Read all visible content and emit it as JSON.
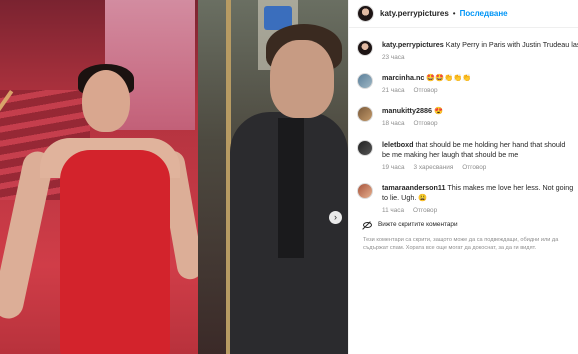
{
  "post": {
    "username": "katy.perrypictures",
    "separator": "•",
    "follow_label": "Последване"
  },
  "caption": {
    "username": "katy.perrypictures",
    "text": "Katy Perry in Paris with Justin Trudeau last night",
    "time": "23 часа"
  },
  "comments": [
    {
      "username": "marcinha.nc",
      "text": "🤩🤩👏👏👏",
      "time": "21 часа",
      "reply_label": "Отговор"
    },
    {
      "username": "manukitty2886",
      "text": "😍",
      "time": "18 часа",
      "reply_label": "Отговор"
    },
    {
      "username": "leletboxd",
      "text": "that should be me holding her hand that should be me making her laugh that should be me",
      "time": "19 часа",
      "likes": "3 харесвания",
      "reply_label": "Отговор"
    },
    {
      "username": "tamaraanderson11",
      "text": "This makes me love her less. Not going to lie. Ugh. 😩",
      "time": "11 часа",
      "reply_label": "Отговор"
    }
  ],
  "hidden_comments": {
    "label": "Вижте скритите коментари",
    "notice": "Тези коментари са скрити, защото може да са подвеждащи, обидни или да съдържат спам. Хората все още могат да докоснат, за да ги видят."
  },
  "media": {
    "next_icon": "chevron-right-icon",
    "next_glyph": "›"
  }
}
